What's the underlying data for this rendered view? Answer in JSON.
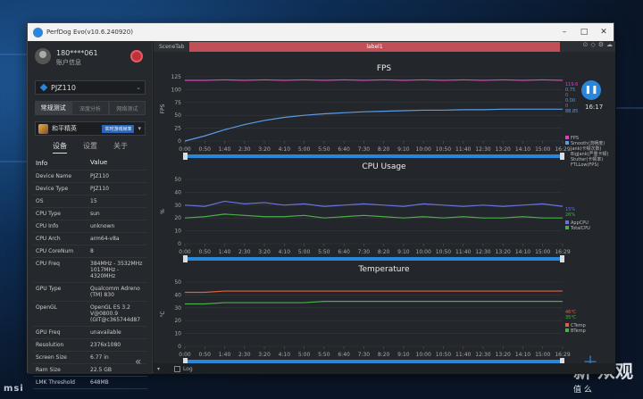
{
  "window": {
    "title": "PerfDog Evo(v10.6.240920)",
    "min": "–",
    "max": "□",
    "close": "✕"
  },
  "user": {
    "name": "180****061",
    "info": "账户信息"
  },
  "device": {
    "name": "PJZ110"
  },
  "mode_tabs": [
    {
      "label": "常规测试"
    },
    {
      "label": "深度分析"
    },
    {
      "label": "网络测试"
    }
  ],
  "app": {
    "name": "和平精英",
    "badge": "实时游戏帧率"
  },
  "sub_tabs": [
    {
      "label": "设备"
    },
    {
      "label": "设置"
    },
    {
      "label": "关于"
    }
  ],
  "info_header": {
    "k": "Info",
    "v": "Value"
  },
  "info_rows": [
    {
      "k": "Device Name",
      "v": "PJZ110"
    },
    {
      "k": "Device Type",
      "v": "PJZ110"
    },
    {
      "k": "OS",
      "v": "15"
    },
    {
      "k": "CPU Type",
      "v": "sun"
    },
    {
      "k": "CPU Info",
      "v": "unknown"
    },
    {
      "k": "CPU Arch",
      "v": "arm64-v8a"
    },
    {
      "k": "CPU CoreNum",
      "v": "8"
    },
    {
      "k": "CPU Freq",
      "v": "384MHz - 3532MHz\n1017MHz -\n4320MHz"
    },
    {
      "k": "GPU Type",
      "v": "Qualcomm Adreno\n(TM) 830"
    },
    {
      "k": "OpenGL",
      "v": "OpenGL ES 3.2\nV@0800.9\n(GIT@c365744d87"
    },
    {
      "k": "GPU Freq",
      "v": "unavailable"
    },
    {
      "k": "Resolution",
      "v": "2376x1080"
    },
    {
      "k": "Screen Size",
      "v": "6.77 in"
    },
    {
      "k": "Ram Size",
      "v": "22.5 GB"
    },
    {
      "k": "LMK Threshold",
      "v": "648MB"
    }
  ],
  "scene": {
    "tab": "SceneTab",
    "label": "label1"
  },
  "controls": {
    "time": "16:17",
    "log": "Log"
  },
  "watermark": {
    "main": "新 众观",
    "sub": "值 么"
  },
  "desktop_logo": "msi",
  "colors": {
    "accent": "#2a86d8",
    "label_bar": "#c04f57"
  },
  "chart_data": [
    {
      "type": "line",
      "title": "FPS",
      "ylabel": "FPS",
      "ylim": [
        0,
        125
      ],
      "yticks": [
        0,
        25,
        50,
        75,
        100,
        125
      ],
      "xticks": [
        "0:00",
        "0:50",
        "1:40",
        "2:30",
        "3:20",
        "4:10",
        "5:00",
        "5:50",
        "6:40",
        "7:30",
        "8:20",
        "9:10",
        "10:00",
        "10:50",
        "11:40",
        "12:30",
        "13:20",
        "14:10",
        "15:00",
        "16:29"
      ],
      "series": [
        {
          "name": "FPS",
          "color": "#e040c0",
          "values": [
            118,
            118,
            119,
            118,
            119,
            118,
            119,
            118,
            119,
            118,
            119,
            118,
            119,
            118,
            119,
            118,
            119,
            118,
            119,
            118
          ]
        },
        {
          "name": "Smooth(流畅度)",
          "color": "#5c9ce6",
          "values": [
            0,
            10,
            22,
            32,
            40,
            46,
            50,
            53,
            55,
            57,
            58,
            59,
            60,
            60,
            61,
            61,
            62,
            62,
            62,
            62
          ]
        }
      ],
      "legend": [
        "Jank(卡顿次数)",
        "BigJank(严重卡顿)",
        "Stutter(卡顿率)",
        "FTLLow(FPS)"
      ],
      "legend_values": [
        "119.6",
        "0.75",
        "0",
        "0.00",
        "0",
        "88.85"
      ]
    },
    {
      "type": "line",
      "title": "CPU Usage",
      "ylabel": "%",
      "ylim": [
        0,
        50
      ],
      "yticks": [
        0,
        10,
        20,
        30,
        40,
        50
      ],
      "xticks": [
        "0:00",
        "0:50",
        "1:40",
        "2:30",
        "3:20",
        "4:10",
        "5:00",
        "5:50",
        "6:40",
        "7:30",
        "8:20",
        "9:10",
        "10:00",
        "10:50",
        "11:40",
        "12:30",
        "13:20",
        "14:10",
        "15:00",
        "16:29"
      ],
      "series": [
        {
          "name": "AppCPU",
          "color": "#6a72e0",
          "values": [
            30,
            29,
            33,
            31,
            32,
            30,
            31,
            29,
            30,
            31,
            30,
            29,
            31,
            30,
            29,
            30,
            29,
            30,
            31,
            29
          ]
        },
        {
          "name": "TotalCPU",
          "color": "#4ab04a",
          "values": [
            20,
            21,
            23,
            22,
            21,
            21,
            22,
            20,
            21,
            22,
            21,
            20,
            21,
            20,
            21,
            20,
            20,
            21,
            20,
            20
          ]
        }
      ],
      "legend_values": [
        "15%",
        "26%"
      ]
    },
    {
      "type": "line",
      "title": "Temperature",
      "ylabel": "°C",
      "ylim": [
        0,
        50
      ],
      "yticks": [
        0,
        10,
        20,
        30,
        40,
        50
      ],
      "xticks": [
        "0:00",
        "0:50",
        "1:40",
        "2:30",
        "3:20",
        "4:10",
        "5:00",
        "5:50",
        "6:40",
        "7:30",
        "8:20",
        "9:10",
        "10:00",
        "10:50",
        "11:40",
        "12:30",
        "13:20",
        "14:10",
        "15:00",
        "16:29"
      ],
      "series": [
        {
          "name": "CTemp",
          "color": "#e06040",
          "values": [
            42,
            42,
            43,
            43,
            43,
            43,
            43,
            43,
            43,
            43,
            43,
            43,
            43,
            43,
            43,
            43,
            43,
            43,
            43,
            43
          ]
        },
        {
          "name": "BTemp",
          "color": "#4ab04a",
          "values": [
            33,
            33,
            34,
            34,
            34,
            34,
            34,
            35,
            35,
            35,
            35,
            35,
            35,
            35,
            35,
            35,
            35,
            35,
            35,
            35
          ]
        }
      ],
      "legend_values": [
        "46℃",
        "35℃"
      ]
    }
  ]
}
